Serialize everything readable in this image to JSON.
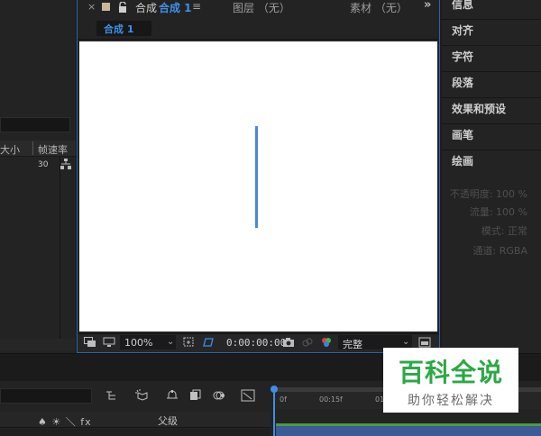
{
  "project": {
    "col_size": "大小",
    "col_fps": "帧速率",
    "row_fps": "30"
  },
  "comp": {
    "close": "×",
    "tab_label": "合成",
    "tab_active": "合成 1",
    "tab_menu": "≡",
    "layer_tab": "图层 （无）",
    "footage_tab": "素材 （无）",
    "overflow": "»",
    "subtab": "合成 1"
  },
  "toolbar": {
    "zoom": "100%",
    "timecode": "0:00:00:00",
    "resolution": "完整",
    "dropdown_arrow": "⌄"
  },
  "right_panel": {
    "items": [
      "信息",
      "对齐",
      "字符",
      "段落",
      "效果和预设",
      "画笔",
      "绘画"
    ],
    "paint": {
      "opacity": "不透明度: 100 %",
      "flow": "流量: 100 %",
      "mode": "模式: 正常",
      "channel": "通道: RGBA"
    }
  },
  "timeline": {
    "switches": "♠ ☀ ＼ fx",
    "parent": "父级",
    "ruler": [
      "0f",
      "00:15f",
      "01"
    ]
  },
  "watermark": {
    "title": "百科全说",
    "subtitle": "助你轻松解决"
  },
  "colors": {
    "accent": "#3d90e8",
    "shape": "#4a89d9",
    "watermark": "#2ca845"
  }
}
